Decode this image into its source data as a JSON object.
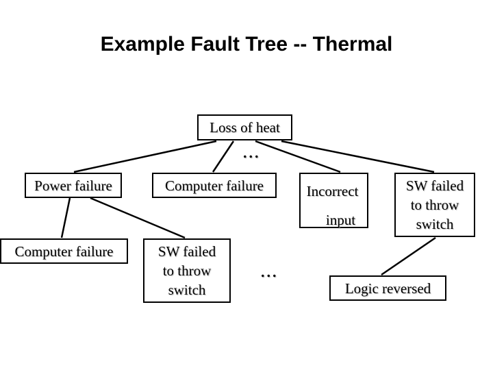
{
  "slide": {
    "title": "Example Fault Tree -- Thermal"
  },
  "tree": {
    "root": {
      "label": "Loss of heat"
    },
    "level1": {
      "power_failure": {
        "label": "Power failure"
      },
      "computer_failure": {
        "label": "Computer failure"
      },
      "incorrect_input": {
        "lines": [
          "Incorrect",
          "input"
        ]
      },
      "sw_failed": {
        "lines": [
          "SW failed",
          "to throw",
          "switch"
        ]
      }
    },
    "level2": {
      "computer_failure": {
        "label": "Computer failure"
      },
      "sw_failed": {
        "lines": [
          "SW failed",
          "to throw",
          "switch"
        ]
      },
      "logic_reversed": {
        "label": "Logic reversed"
      }
    },
    "ellipsis_top": "...",
    "ellipsis_bottom": "..."
  },
  "colors": {
    "line": "#000000",
    "background": "#ffffff",
    "text": "#000000"
  }
}
